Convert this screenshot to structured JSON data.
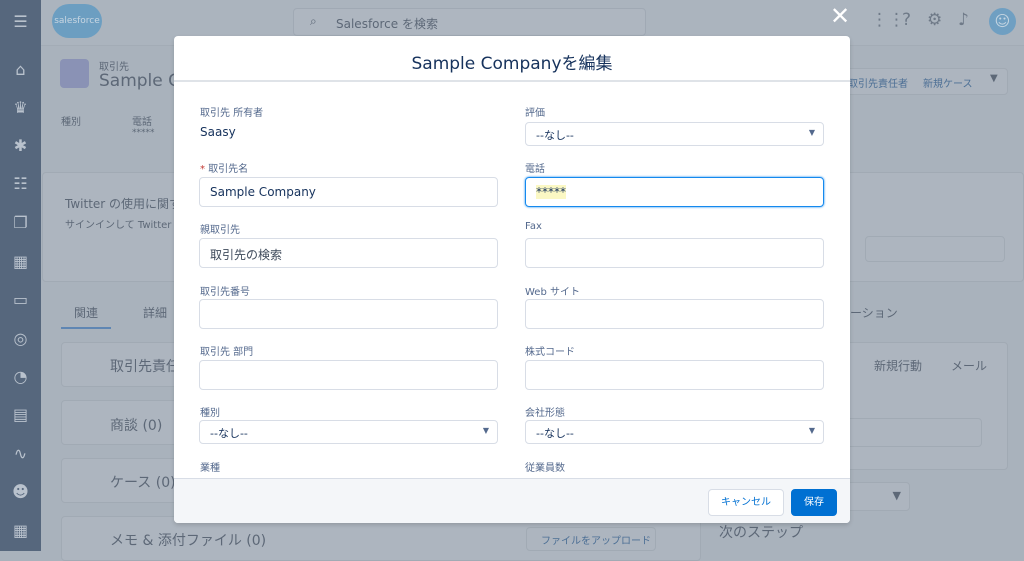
{
  "app": {
    "logo": "salesforce",
    "search_placeholder": "Salesforce を検索"
  },
  "sidebar": {
    "icons": [
      "menu-icon",
      "home-icon",
      "opportunity-icon",
      "lead-icon",
      "task-icon",
      "file-icon",
      "account-icon",
      "contact-icon",
      "target-icon",
      "dashboard-icon",
      "report-icon",
      "activity-icon",
      "group-icon",
      "calendar-icon"
    ]
  },
  "record": {
    "object": "取引先",
    "name": "Sample Company",
    "field1_label": "種別",
    "field2_label": "電話",
    "field2_value": "*****",
    "actions": [
      "取引先責任者",
      "新規ケース"
    ],
    "twitter_title": "Twitter の使用に関する",
    "twitter_sub": "サインインして Twitter フ",
    "tabs": [
      "関連",
      "詳細"
    ],
    "related": [
      "取引先責任",
      "商談 (0)",
      "ケース (0)",
      "メモ & 添付ファイル (0)"
    ],
    "upload": "ファイルをアップロード",
    "activity_tab": "ーション",
    "activity_actions": [
      "新規行動",
      "メール"
    ],
    "next_steps": "次のステップ"
  },
  "modal": {
    "title": "Sample Companyを編集",
    "close": "✕",
    "left": [
      {
        "label": "取引先 所有者",
        "value": "Saasy"
      },
      {
        "label": "取引先名",
        "required": true,
        "value": "Sample Company"
      },
      {
        "label": "親取引先",
        "placeholder": "取引先の検索"
      },
      {
        "label": "取引先番号",
        "value": ""
      },
      {
        "label": "取引先 部門",
        "value": ""
      },
      {
        "label": "種別",
        "value": "--なし--"
      },
      {
        "label": "業種"
      }
    ],
    "right": [
      {
        "label": "評価",
        "value": "--なし--"
      },
      {
        "label": "電話",
        "value": "*****"
      },
      {
        "label": "Fax",
        "value": ""
      },
      {
        "label": "Web サイト",
        "value": ""
      },
      {
        "label": "株式コード",
        "value": ""
      },
      {
        "label": "会社形態",
        "value": "--なし--"
      },
      {
        "label": "従業員数"
      }
    ],
    "cancel": "キャンセル",
    "save": "保存",
    "save_color": "#0070d2"
  }
}
